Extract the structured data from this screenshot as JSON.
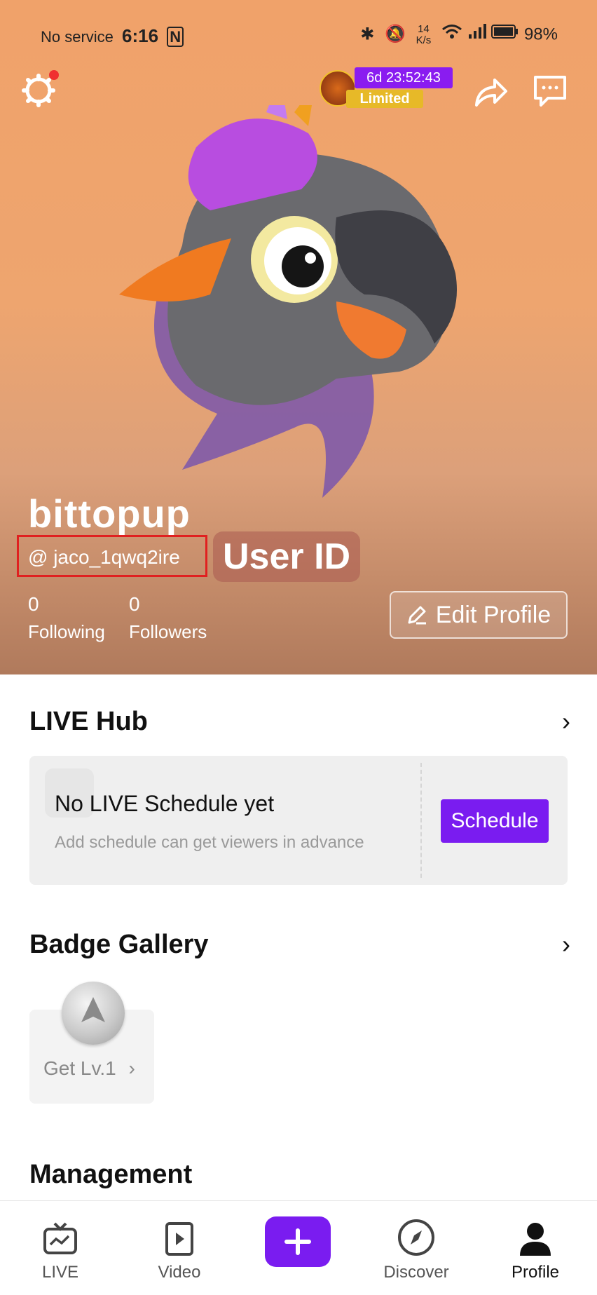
{
  "status_bar": {
    "carrier": "No service",
    "time": "6:16",
    "speed_top": "14",
    "speed_bottom": "K/s",
    "battery": "98%"
  },
  "promo": {
    "timer": "6d 23:52:43",
    "tag": "Limited"
  },
  "profile": {
    "username": "bittopup",
    "handle": "@ jaco_1qwq2ire",
    "annotation": "User ID",
    "following_count": "0",
    "following_label": "Following",
    "followers_count": "0",
    "followers_label": "Followers",
    "edit_label": "Edit Profile"
  },
  "live_hub": {
    "title": "LIVE Hub",
    "schedule_title": "No LIVE Schedule yet",
    "schedule_sub": "Add schedule can get viewers in advance",
    "schedule_button": "Schedule"
  },
  "badge_gallery": {
    "title": "Badge Gallery",
    "badge_label": "Get Lv.1"
  },
  "management": {
    "title": "Management"
  },
  "tabs": [
    {
      "label": "LIVE",
      "icon": "live-tv-icon"
    },
    {
      "label": "Video",
      "icon": "video-icon"
    },
    {
      "label": "",
      "icon": "plus-icon"
    },
    {
      "label": "Discover",
      "icon": "compass-icon"
    },
    {
      "label": "Profile",
      "icon": "person-icon"
    }
  ],
  "colors": {
    "accent": "#7a1cf0",
    "header": "#eea56f",
    "highlight_box": "#e02020"
  }
}
